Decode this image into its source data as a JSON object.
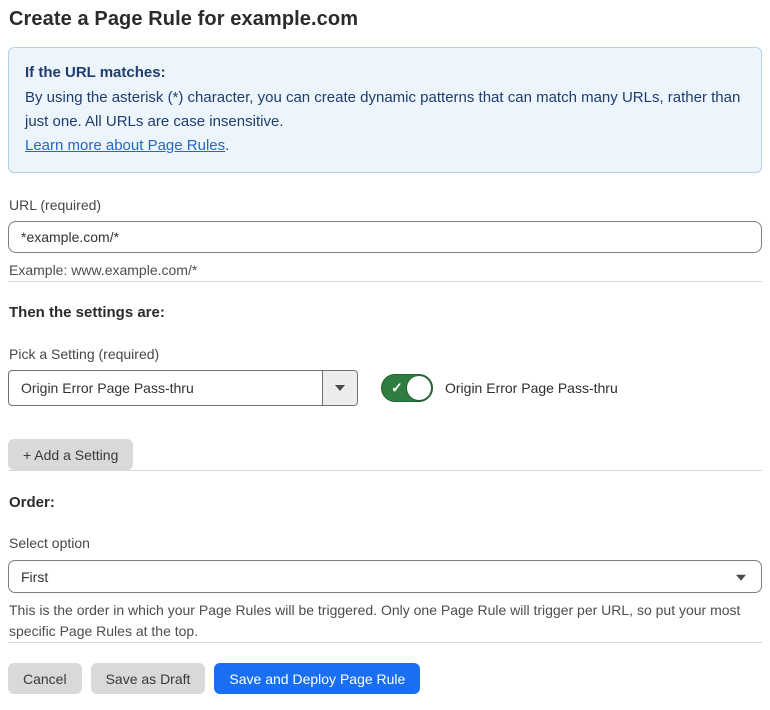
{
  "page": {
    "title": "Create a Page Rule for example.com"
  },
  "info_box": {
    "heading": "If the URL matches:",
    "body": "By using the asterisk (*) character, you can create dynamic patterns that can match many URLs, rather than just one. All URLs are case insensitive.",
    "link_label": "Learn more about Page Rules",
    "link_suffix": "."
  },
  "url_section": {
    "label": "URL (required)",
    "value": "*example.com/*",
    "helper": "Example: www.example.com/*"
  },
  "settings_section": {
    "heading": "Then the settings are:",
    "picker_label": "Pick a Setting (required)",
    "selected_setting": "Origin Error Page Pass-thru",
    "toggle_state": "on",
    "toggle_check_glyph": "✓",
    "toggle_label": "Origin Error Page Pass-thru",
    "add_setting_label": "+ Add a Setting"
  },
  "order_section": {
    "heading": "Order:",
    "select_label": "Select option",
    "selected_option": "First",
    "helper": "This is the order in which your Page Rules will be triggered. Only one Page Rule will trigger per URL, so put your most specific Page Rules at the top."
  },
  "footer": {
    "cancel_label": "Cancel",
    "save_draft_label": "Save as Draft",
    "save_deploy_label": "Save and Deploy Page Rule"
  },
  "colors": {
    "info_bg": "#ecf4fc",
    "info_border": "#b3d3f0",
    "info_text": "#1f3d6d",
    "link_blue": "#2767c4",
    "toggle_green": "#2e7d41",
    "primary_blue": "#1a6ef2",
    "button_gray": "#d9d9d9"
  }
}
